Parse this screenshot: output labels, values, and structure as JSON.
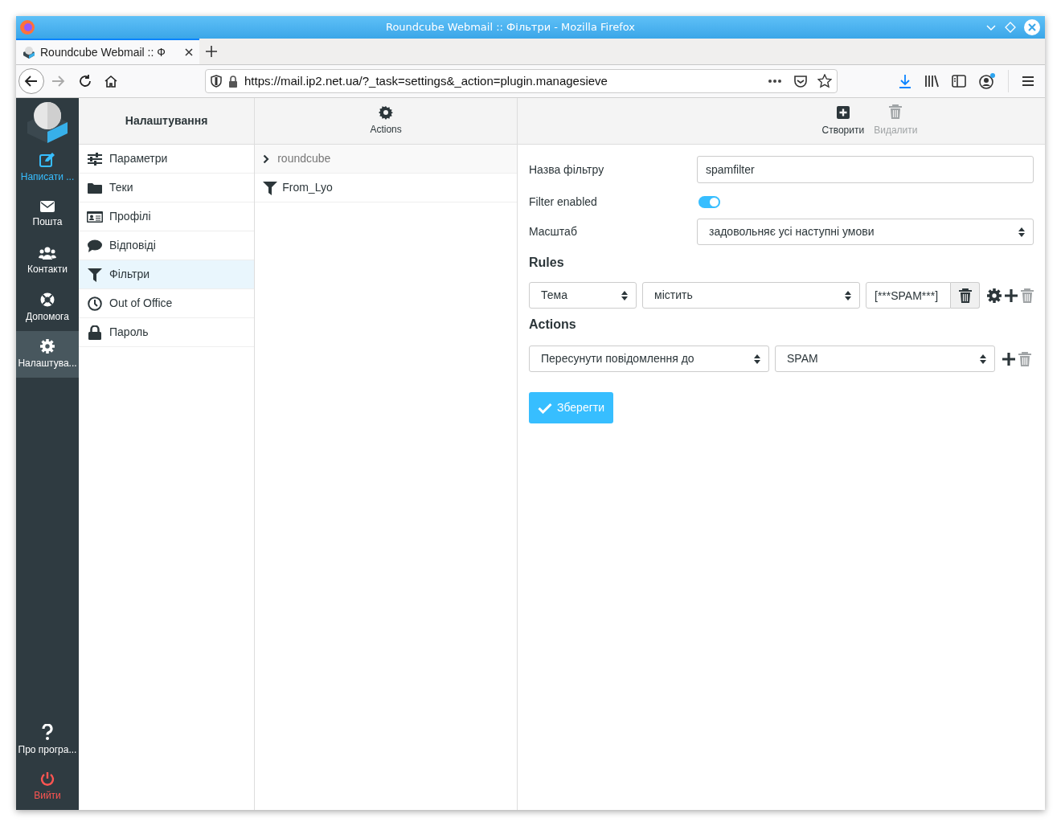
{
  "window": {
    "title": "Roundcube Webmail :: Фільтри - Mozilla Firefox"
  },
  "tabs": [
    {
      "label": "Roundcube Webmail :: Ф",
      "selected": true
    }
  ],
  "address_bar": {
    "url": "https://mail.ip2.net.ua/?_task=settings&_action=plugin.managesieve"
  },
  "app_nav": [
    {
      "label": "Написати ...",
      "kind": "action",
      "selected": false
    },
    {
      "label": "Пошта",
      "kind": "nav",
      "selected": false
    },
    {
      "label": "Контакти",
      "kind": "nav",
      "selected": false
    },
    {
      "label": "Допомога",
      "kind": "nav",
      "selected": false
    },
    {
      "label": "Налаштува...",
      "kind": "nav",
      "selected": true
    }
  ],
  "app_nav_bottom": [
    {
      "label": "Про програ...",
      "kind": "nav"
    },
    {
      "label": "Вийти",
      "kind": "logout"
    }
  ],
  "settings_panel": {
    "title": "Налаштування",
    "items": [
      {
        "label": "Параметри",
        "selected": false
      },
      {
        "label": "Теки",
        "selected": false
      },
      {
        "label": "Профілі",
        "selected": false
      },
      {
        "label": "Відповіді",
        "selected": false
      },
      {
        "label": "Фільтри",
        "selected": true
      },
      {
        "label": "Out of Office",
        "selected": false
      },
      {
        "label": "Пароль",
        "selected": false
      }
    ]
  },
  "filters_panel": {
    "toolbar_label": "Actions",
    "filter_set": "roundcube",
    "filters": [
      {
        "label": "From_Lyo"
      }
    ]
  },
  "toolbar": [
    {
      "label": "Створити",
      "disabled": false
    },
    {
      "label": "Видалити",
      "disabled": true
    }
  ],
  "form": {
    "name_label": "Назва фільтру",
    "name_value": "spamfilter",
    "enabled_label": "Filter enabled",
    "enabled": true,
    "scope_label": "Масштаб",
    "scope_value": "задовольняє усі наступні умови",
    "rules_heading": "Rules",
    "rules": [
      {
        "header": "Тема",
        "operator": "містить",
        "value": "[***SPAM***]"
      }
    ],
    "actions_heading": "Actions",
    "actions": [
      {
        "type": "Пересунути повідомлення до",
        "target": "SPAM"
      }
    ],
    "save_label": "Зберегти"
  }
}
